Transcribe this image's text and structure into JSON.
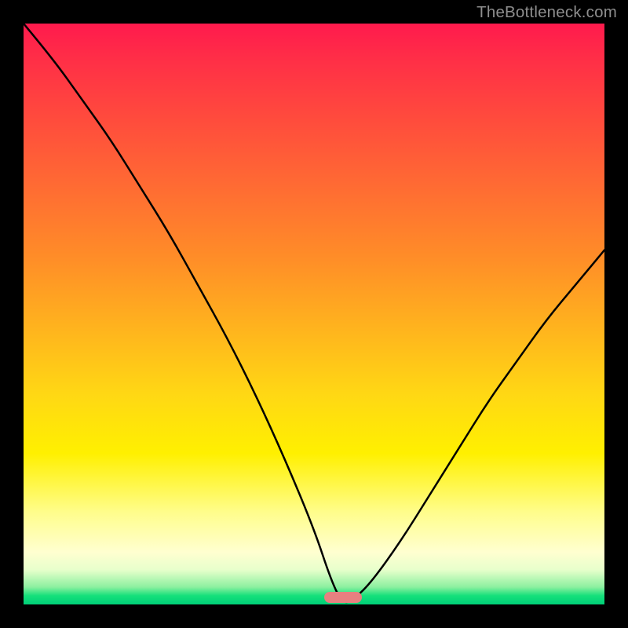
{
  "watermark": {
    "text": "TheBottleneck.com"
  },
  "colors": {
    "frame": "#000000",
    "curve": "#000000",
    "marker": "#e88080",
    "gradient_stops": [
      "#ff1a4d",
      "#ff2e47",
      "#ff4a3d",
      "#ff6b33",
      "#ff8c28",
      "#ffb21e",
      "#ffd814",
      "#fff000",
      "#fffd8a",
      "#ffffd0",
      "#e8ffcc",
      "#8cf0a0",
      "#15e07a",
      "#00cf78"
    ]
  },
  "chart_data": {
    "type": "line",
    "title": "",
    "xlabel": "",
    "ylabel": "",
    "xlim": [
      0,
      100
    ],
    "ylim": [
      0,
      100
    ],
    "series": [
      {
        "name": "bottleneck-curve",
        "x": [
          0,
          5,
          10,
          15,
          20,
          25,
          30,
          35,
          40,
          45,
          50,
          53,
          55,
          57,
          60,
          65,
          70,
          75,
          80,
          85,
          90,
          95,
          100
        ],
        "y": [
          100,
          94,
          87,
          80,
          72,
          64,
          55,
          46,
          36,
          25,
          13,
          4,
          0,
          1,
          4,
          11,
          19,
          27,
          35,
          42,
          49,
          55,
          61
        ]
      }
    ],
    "annotations": [
      {
        "name": "optimal-marker",
        "x": 55,
        "y": 0,
        "shape": "pill"
      }
    ],
    "grid": false,
    "legend": false
  }
}
